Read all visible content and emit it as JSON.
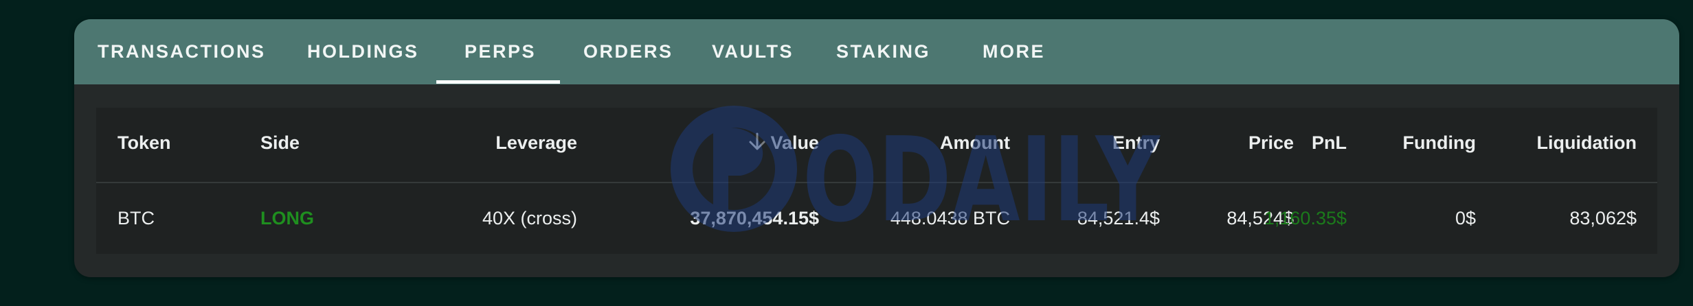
{
  "tabs": [
    {
      "label": "TRANSACTIONS"
    },
    {
      "label": "HOLDINGS"
    },
    {
      "label": "PERPS"
    },
    {
      "label": "ORDERS"
    },
    {
      "label": "VAULTS"
    },
    {
      "label": "STAKING"
    },
    {
      "label": "MORE"
    }
  ],
  "active_tab": "PERPS",
  "table": {
    "headers": {
      "token": "Token",
      "side": "Side",
      "leverage": "Leverage",
      "value": "Value",
      "amount": "Amount",
      "entry": "Entry",
      "price": "Price",
      "pnl": "PnL",
      "funding": "Funding",
      "liquidation": "Liquidation"
    },
    "sort_column": "value",
    "sort_direction": "desc",
    "rows": [
      {
        "token": "BTC",
        "side": "LONG",
        "leverage": "40X (cross)",
        "value": "37,870,454.15$",
        "amount": "448.0438 BTC",
        "entry": "84,521.4$",
        "price": "84,524$",
        "pnl": "1,160.35$",
        "funding": "0$",
        "liquidation": "83,062$"
      }
    ]
  },
  "watermark": {
    "text": "ODAILY"
  },
  "colors": {
    "background": "#03201c",
    "tabbar": "#4d7771",
    "card": "#252929",
    "positive": "#1f8f1f",
    "pnl_positive": "#1b7a1b",
    "watermark": "#1e3a78"
  },
  "icons": {
    "sort": "arrow-down-icon"
  }
}
